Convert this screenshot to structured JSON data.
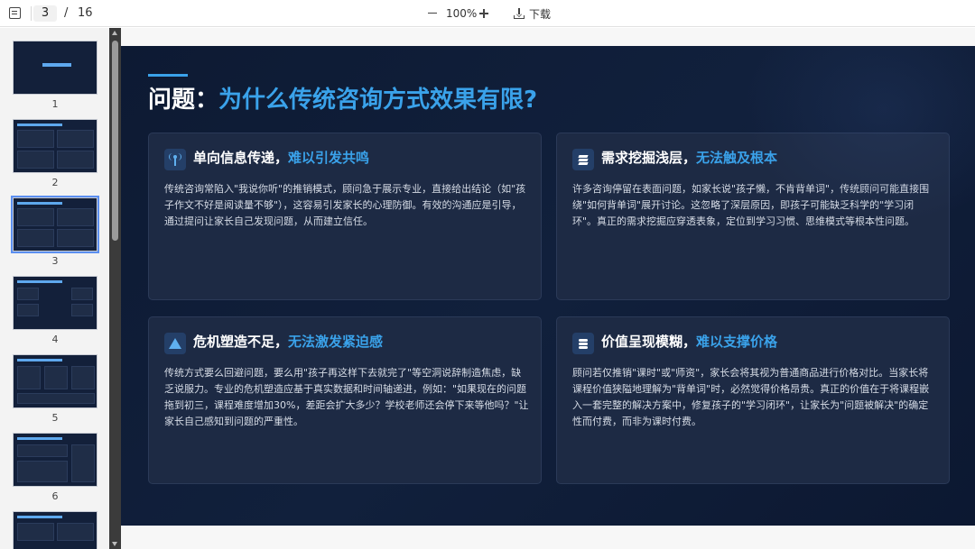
{
  "toolbar": {
    "current_page": "3",
    "page_separator": "/",
    "total_pages": "16",
    "zoom_level": "100%",
    "download_label": "下载"
  },
  "thumbnails": [
    {
      "num": "1",
      "active": false
    },
    {
      "num": "2",
      "active": false
    },
    {
      "num": "3",
      "active": true
    },
    {
      "num": "4",
      "active": false
    },
    {
      "num": "5",
      "active": false
    },
    {
      "num": "6",
      "active": false
    },
    {
      "num": "",
      "active": false
    }
  ],
  "slide": {
    "title_prefix": "问题：",
    "title_highlight": "为什么传统咨询方式效果有限?",
    "cards": [
      {
        "icon": "antenna-icon",
        "title_plain": "单向信息传递，",
        "title_highlight": "难以引发共鸣",
        "body": "传统咨询常陷入\"我说你听\"的推销模式，顾问急于展示专业，直接给出结论（如\"孩子作文不好是阅读量不够\"），这容易引发家长的心理防御。有效的沟通应是引导，通过提问让家长自己发现问题，从而建立信任。"
      },
      {
        "icon": "layers-icon",
        "title_plain": "需求挖掘浅层，",
        "title_highlight": "无法触及根本",
        "body": "许多咨询停留在表面问题，如家长说\"孩子懒，不肯背单词\"，传统顾问可能直接围绕\"如何背单词\"展开讨论。这忽略了深层原因，即孩子可能缺乏科学的\"学习闭环\"。真正的需求挖掘应穿透表象，定位到学习习惯、思维模式等根本性问题。"
      },
      {
        "icon": "warning-icon",
        "title_plain": "危机塑造不足，",
        "title_highlight": "无法激发紧迫感",
        "body": "传统方式要么回避问题，要么用\"孩子再这样下去就完了\"等空洞说辞制造焦虑，缺乏说服力。专业的危机塑造应基于真实数据和时间轴递进，例如：\"如果现在的问题拖到初三，课程难度增加30%，差距会扩大多少？学校老师还会停下来等他吗？\"让家长自己感知到问题的严重性。"
      },
      {
        "icon": "coins-icon",
        "title_plain": "价值呈现模糊，",
        "title_highlight": "难以支撑价格",
        "body": "顾问若仅推销\"课时\"或\"师资\"，家长会将其视为普通商品进行价格对比。当家长将课程价值狭隘地理解为\"背单词\"时，必然觉得价格昂贵。真正的价值在于将课程嵌入一套完整的解决方案中，修复孩子的\"学习闭环\"，让家长为\"问题被解决\"的确定性而付费，而非为课时付费。"
      }
    ]
  },
  "colors": {
    "accent": "#3aa2ea",
    "slide_bg": "#0f1d38",
    "card_bg": "#1d2a44"
  }
}
